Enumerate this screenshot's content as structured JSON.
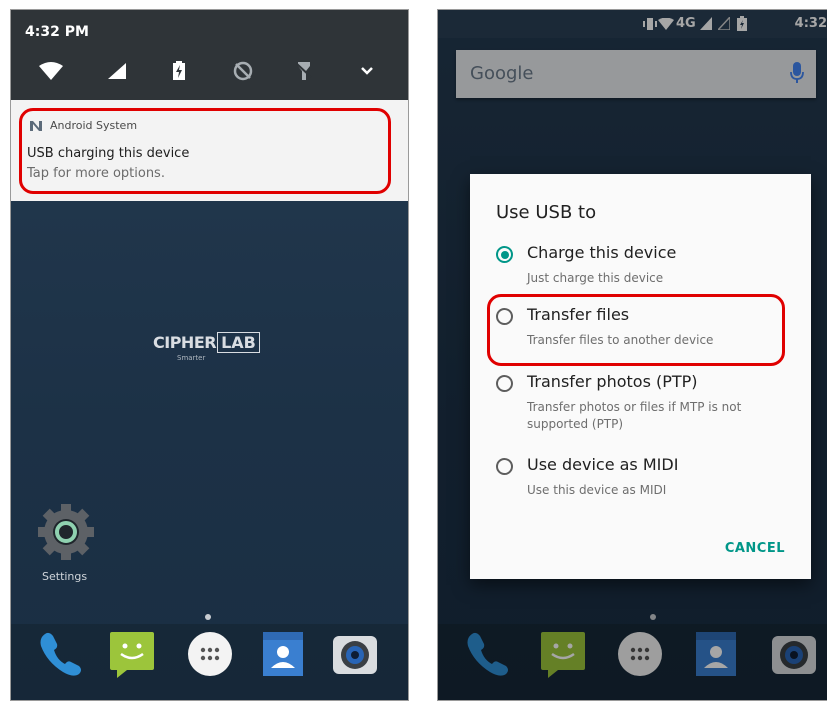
{
  "left_screen": {
    "time": "4:32 PM",
    "notification": {
      "app_name": "Android System",
      "title": "USB charging this device",
      "subtitle": "Tap for more options."
    },
    "logo": {
      "text": "CIPHER",
      "box_text": "LAB",
      "tagline": "Smarter"
    },
    "settings_label": "Settings"
  },
  "right_screen": {
    "status": {
      "signal_label": "4G",
      "time": "4:32"
    },
    "search": {
      "brand": "Google"
    },
    "dialog": {
      "title": "Use USB to",
      "options": [
        {
          "label": "Charge this device",
          "sub": "Just charge this device",
          "selected": true
        },
        {
          "label": "Transfer files",
          "sub": "Transfer files to another device",
          "selected": false
        },
        {
          "label": "Transfer photos (PTP)",
          "sub": "Transfer photos or files if MTP is not supported (PTP)",
          "selected": false
        },
        {
          "label": "Use device as MIDI",
          "sub": "Use this device as MIDI",
          "selected": false
        }
      ],
      "cancel": "CANCEL"
    }
  },
  "colors": {
    "highlight": "#e00000",
    "accent": "#009688"
  }
}
